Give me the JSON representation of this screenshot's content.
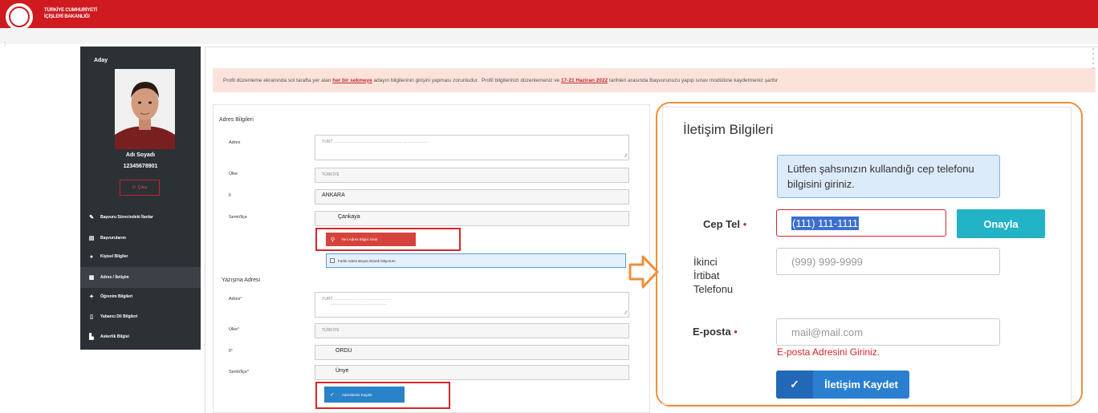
{
  "header": {
    "org_line1": "TÜRKİYE CUMHURİYETİ",
    "org_line2": "İÇİŞLERİ BAKANLIĞI",
    "logo": "ministry-seal-icon",
    "brand_color": "#cf1a1f"
  },
  "sidebar": {
    "role": "Aday",
    "name": "Adı Soyadı",
    "id_number": "12345678901",
    "logout_label": "Çıkış",
    "items": [
      {
        "label": "Başvuru Sürecindeki İlanlar",
        "icon": "edit-icon",
        "active": false
      },
      {
        "label": "Başvurularım",
        "icon": "document-icon",
        "active": false
      },
      {
        "label": "Kişisel Bilgiler",
        "icon": "user-icon",
        "active": false
      },
      {
        "label": "Adres / İletişim",
        "icon": "address-card-icon",
        "active": true
      },
      {
        "label": "Öğrenim Bilgileri",
        "icon": "graduation-icon",
        "active": false
      },
      {
        "label": "Yabancı Dil Bilgileri",
        "icon": "book-icon",
        "active": false
      },
      {
        "label": "Askerlik Bilgisi",
        "icon": "military-icon",
        "active": false
      }
    ]
  },
  "alert": {
    "text_1": "Profil düzenleme ekranında sol tarafta yer alan ",
    "link_1": "her bir sekmeye",
    "text_2": " adayın bilgilerinin girişini yapması zorunludur.  Profil bilgilerinizi düzenlemeniz ve ",
    "link_2": "17-21 Haziran 2022",
    "text_3": " tarihleri arasında Başvurunuzu yapıp sınav modülüne kaydetmeniz şarttır"
  },
  "address": {
    "title": "Adres Bilgileri",
    "adres_label": "Adres",
    "adres_value": "YURT ………………  ……………………………  ..  ……………",
    "ulke_label": "Ülke",
    "ulke_value": "TÜRKİYE",
    "il_label": "İl",
    "il_value": "ANKARA",
    "semt_label": "Semt/İlçe",
    "semt_value": "Çankaya",
    "fetch_button": "Yeni Adres Bilgisi Getir",
    "diff_address_label": "Farklı Adres Beyan Etmek İstiyorum."
  },
  "correspondence": {
    "title": "Yazışma Adresi",
    "adres_label": "Adres",
    "adres_line1": "YURT …………… ….  ………………….",
    "adres_line2": "……………………………………",
    "ulke_label": "Ülke",
    "ulke_value": "TÜRKİYE",
    "il_label": "İl",
    "il_value": "ORDU",
    "semt_label": "Semt/İlçe",
    "semt_value": "Ünye",
    "save_button": "Adreslerimi Kaydet",
    "required_mark": "*"
  },
  "contact": {
    "title": "İletişim Bilgileri",
    "info": "Lütfen şahsınızın kullandığı cep telefonu bilgisini giriniz.",
    "cep_label": "Cep Tel",
    "cep_value": "(111) 111-1111",
    "confirm_button": "Onayla",
    "second_label_1": "İkinci",
    "second_label_2": "İrtibat",
    "second_label_3": "Telefonu",
    "second_placeholder": "(999) 999-9999",
    "email_label": "E-posta",
    "email_placeholder": "mail@mail.com",
    "email_error": "E-posta Adresini Giriniz.",
    "save_button": "İletişim Kaydet",
    "accent_color": "#ed8f3a"
  }
}
